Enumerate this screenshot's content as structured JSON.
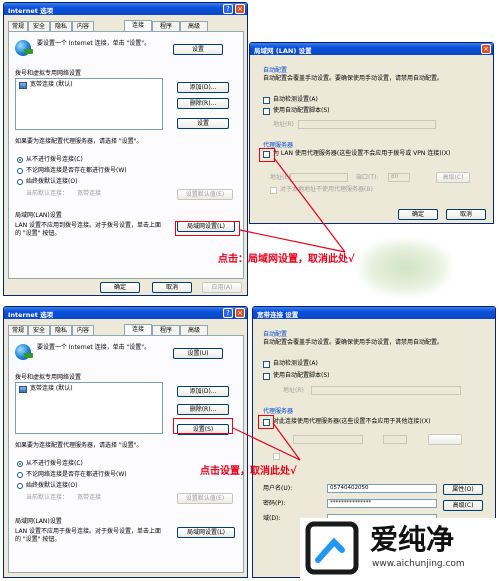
{
  "top": {
    "internet_options": {
      "title": "Internet 选项",
      "tabs": [
        "常规",
        "安全",
        "隐私",
        "内容",
        "连接",
        "程序",
        "高级"
      ],
      "intro_text": "要设置一个 Internet 连接，单击 \"设置\"。",
      "setup_button": "设置",
      "dialup_group_label": "拨号和虚拟专用网络设置",
      "connections": [
        "宽带连接 (默认)"
      ],
      "add_button": "添加(D)...",
      "remove_button": "删除(R)...",
      "settings_button": "设置",
      "proxy_hint": "如果要为连接配置代理服务器，请选择 \"设置\"。",
      "radio_options": [
        {
          "label": "从不进行拨号连接(C)",
          "selected": true
        },
        {
          "label": "不论网络连接是否存在都进行拨号(W)",
          "selected": false
        },
        {
          "label": "始终拨默认连接(O)",
          "selected": false
        }
      ],
      "current_default_label": "当前默认连接：",
      "current_default_value": "宽带连接",
      "set_default_button": "设置默认值(E)",
      "lan_group_label": "局域网(LAN)设置",
      "lan_text": "LAN 设置不应用到拨号连接。对于拨号设置，单击上面的 \"设置\" 按钮。",
      "lan_button": "局域网设置(L)",
      "ok": "确定",
      "cancel": "取消",
      "apply": "应用(A)"
    },
    "lan_settings": {
      "title": "局域网 (LAN) 设置",
      "auto_config_label": "自动配置",
      "auto_config_text": "自动配置会覆盖手动设置。要确保使用手动设置，请禁用自动配置。",
      "auto_detect": "自动检测设置(A)",
      "use_script": "使用自动配置脚本(S)",
      "address_label": "地址(R)",
      "proxy_label": "代理服务器",
      "use_proxy": "为 LAN 使用代理服务器(这些设置不会应用于拨号或 VPN 连接)(X)",
      "proxy_address": "地址(E):",
      "proxy_port": "端口(T):",
      "port_value": "80",
      "advanced": "高级(C)",
      "bypass_local": "对于本地地址不使用代理服务器(B)",
      "ok": "确定",
      "cancel": "取消"
    },
    "annotation": "点击：局域网设置，取消此处√"
  },
  "bottom": {
    "internet_options": {
      "title": "Internet 选项",
      "tabs": [
        "常规",
        "安全",
        "隐私",
        "内容",
        "连接",
        "程序",
        "高级"
      ],
      "intro_text": "要设置一个 Internet 连接，单击 \"设置\"。",
      "setup_button": "设置(U)",
      "dialup_group_label": "拨号和虚拟专用网络设置",
      "connections": [
        "宽带连接 (默认)"
      ],
      "add_button": "添加(D)...",
      "remove_button": "删除(R)...",
      "settings_button": "设置(S)",
      "proxy_hint": "如果要为连接配置代理服务器，请选择 \"设置\"。",
      "radio_options": [
        {
          "label": "从不进行拨号连接(C)",
          "selected": true
        },
        {
          "label": "不论网络连接是否存在都进行拨号(W)",
          "selected": false
        },
        {
          "label": "始终拨默认连接(O)",
          "selected": false
        }
      ],
      "current_default_label": "当前默认连接：",
      "current_default_value": "宽带连接",
      "set_default_button": "设置默认值(E)",
      "lan_group_label": "局域网(LAN)设置",
      "lan_text": "LAN 设置不应用于拨号连接。对于拨号设置，单击上面的 \"设置\" 按钮。",
      "lan_button": "局域网设置(L)"
    },
    "broadband_settings": {
      "title": "宽带连接 设置",
      "auto_config_label": "自动配置",
      "auto_config_text": "自动配置会覆盖手动设置。要确保使用手动设置，请禁用自动配置。",
      "auto_detect": "自动检测设置(A)",
      "use_script": "使用自动配置脚本(S)",
      "address_label": "地址(R)",
      "proxy_label": "代理服务器",
      "use_proxy": "对此连接使用代理服务器(这些设置不会应用于其他连接)(X)",
      "username_label": "用户名(U):",
      "username_value": "05740402050",
      "password_label": "密码(P):",
      "password_value": "***************",
      "domain_label": "域(D):",
      "properties_button": "属性(O)",
      "advanced_button": "高级(C)"
    },
    "annotation": "点击设置，取消此处√"
  },
  "watermark": {
    "brand": "爱纯净",
    "url": "www.aichunjing.com"
  }
}
